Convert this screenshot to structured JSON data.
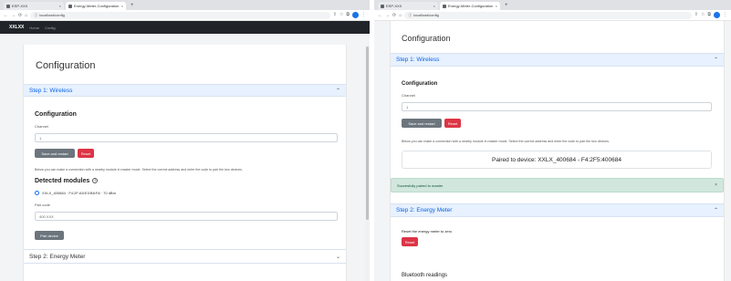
{
  "left": {
    "tabs": [
      {
        "label": "ESP-XXX",
        "active": false
      },
      {
        "label": "Energy-Meter-Configuration",
        "active": true
      }
    ],
    "address": "localhost/config",
    "nav": {
      "brand": "XXLXX",
      "links": [
        "Home",
        "Config"
      ]
    },
    "page_title": "Configuration",
    "step1": {
      "title": "Step 1: Wireless"
    },
    "config_heading": "Configuration",
    "channel_label": "Channel",
    "channel_value": "1",
    "save_button": "Save and restart",
    "reset_button": "Reset",
    "note": "Below you can make a connection with a nearby module in master mode. Select the correct address and enter the code to pair the two devices.",
    "detected_heading": "Detected modules",
    "module_item": "XXLX_400684 · F4:2F:A5:E3:B8:FA · 70 dBm",
    "pair_code_label": "Pair code",
    "pair_code_value": "400 XXX",
    "pair_button": "Pair device",
    "step2": {
      "title": "Step 2: Energy Meter"
    }
  },
  "right": {
    "tabs": [
      {
        "label": "ESP-XXX",
        "active": false
      },
      {
        "label": "Energy-Meter-Configuration",
        "active": true
      }
    ],
    "address": "localhost/config",
    "page_title": "Configuration",
    "step1": {
      "title": "Step 1: Wireless"
    },
    "config_heading": "Configuration",
    "channel_label": "Channel",
    "channel_value": "1",
    "save_button": "Save and restart",
    "reset_button": "Reset",
    "note": "Below you can make a connection with a nearby module in master mode. Select the correct address and enter the code to pair the two devices.",
    "paired_text": "Paired to device: XXLX_400684 - F4:2F5:400684",
    "alert": "Succesfully paired to master",
    "step2": {
      "title": "Step 2: Energy Meter"
    },
    "reset_meter_text": "Reset the energy meter to zero",
    "reset_meter_button": "Reset",
    "bottom_heading": "Bluetooth readings"
  }
}
